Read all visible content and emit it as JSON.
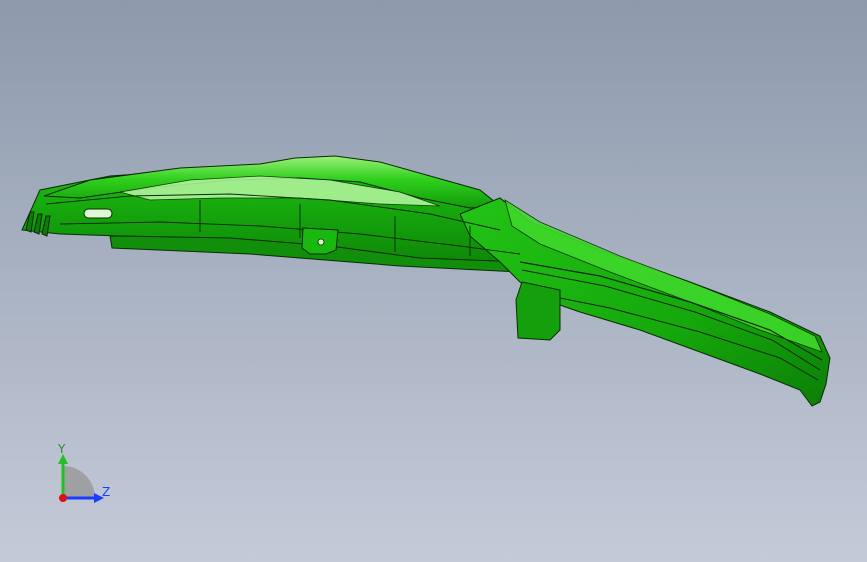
{
  "viewport": {
    "background_top": "#8c9aac",
    "background_bottom": "#c5cad8"
  },
  "model": {
    "part_color": "#19b80f",
    "edge_color": "#0b2a06"
  },
  "triad": {
    "y_label": "Y",
    "z_label": "Z",
    "y_color": "#22c022",
    "z_color": "#1e3cff",
    "x_color": "#e01010"
  }
}
